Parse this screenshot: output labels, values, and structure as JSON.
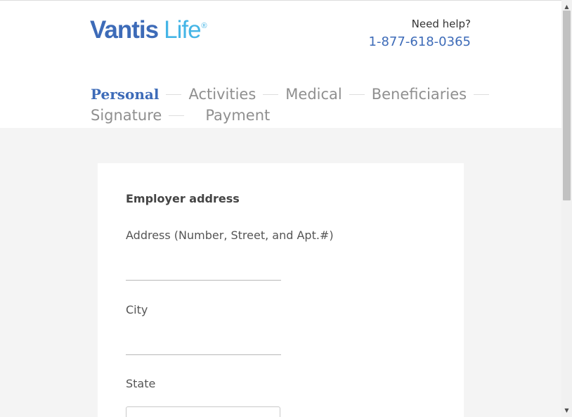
{
  "brand": {
    "name_bold": "Vantis",
    "name_light": "Life",
    "registered_mark": "®",
    "colors": {
      "primary": "#3d6bb8",
      "accent": "#45b5e6"
    }
  },
  "help": {
    "label": "Need help?",
    "phone": "1-877-618-0365"
  },
  "steps": [
    {
      "label": "Personal",
      "active": true
    },
    {
      "label": "Activities",
      "active": false
    },
    {
      "label": "Medical",
      "active": false
    },
    {
      "label": "Beneficiaries",
      "active": false
    },
    {
      "label": "Signature",
      "active": false
    },
    {
      "label": "Payment",
      "active": false
    }
  ],
  "form": {
    "section_title": "Employer address",
    "address_label": "Address (Number, Street, and Apt.#)",
    "address_value": "",
    "city_label": "City",
    "city_value": "",
    "state_label": "State"
  },
  "scrollbar": {
    "up_icon": "triangle-up",
    "down_icon": "triangle-down"
  }
}
